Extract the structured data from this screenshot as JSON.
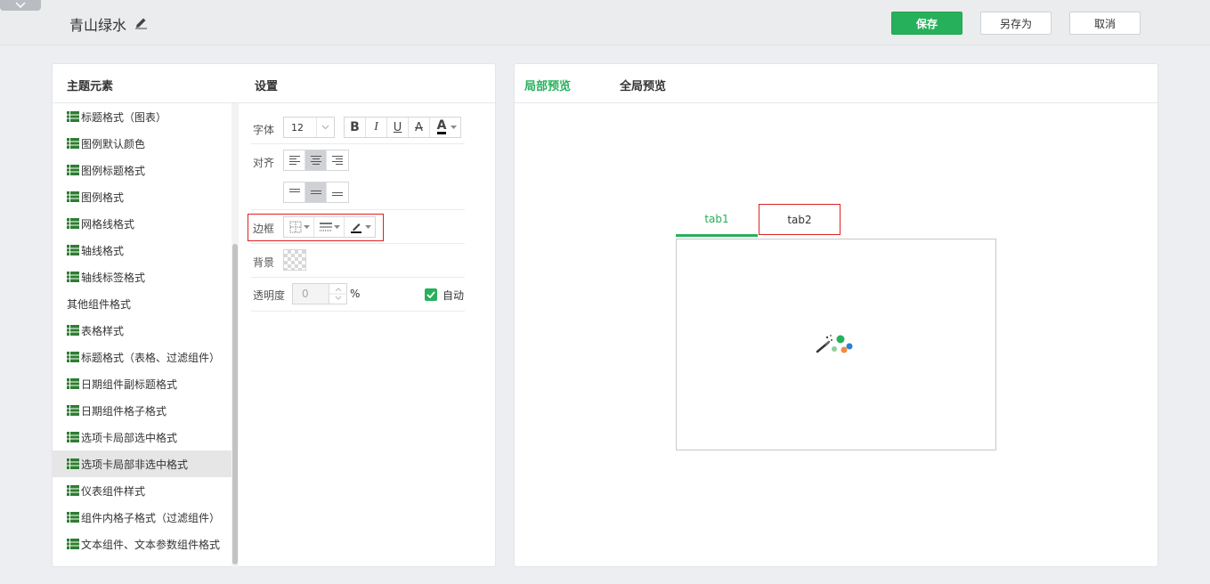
{
  "header": {
    "title": "青山绿水",
    "save_label": "保存",
    "save_as_label": "另存为",
    "cancel_label": "取消"
  },
  "left_panel": {
    "elements_header": "主题元素",
    "settings_header": "设置",
    "elements": [
      {
        "label": "标题格式（图表）",
        "icon": "list-icon"
      },
      {
        "label": "图例默认颜色",
        "icon": "list-icon"
      },
      {
        "label": "图例标题格式",
        "icon": "list-icon"
      },
      {
        "label": "图例格式",
        "icon": "list-icon"
      },
      {
        "label": "网格线格式",
        "icon": "list-icon"
      },
      {
        "label": "轴线格式",
        "icon": "list-icon"
      },
      {
        "label": "轴线标签格式",
        "icon": "list-icon"
      },
      {
        "label": "其他组件格式",
        "icon": ""
      },
      {
        "label": "表格样式",
        "icon": "list-icon"
      },
      {
        "label": "标题格式（表格、过滤组件）",
        "icon": "list-icon"
      },
      {
        "label": "日期组件副标题格式",
        "icon": "list-icon"
      },
      {
        "label": "日期组件格子格式",
        "icon": "list-icon"
      },
      {
        "label": "选项卡局部选中格式",
        "icon": "list-icon"
      },
      {
        "label": "选项卡局部非选中格式",
        "icon": "list-icon",
        "selected": true
      },
      {
        "label": "仪表组件样式",
        "icon": "list-icon"
      },
      {
        "label": "组件内格子格式（过滤组件）",
        "icon": "list-icon"
      },
      {
        "label": "文本组件、文本参数组件格式",
        "icon": "list-icon"
      }
    ],
    "settings": {
      "font_label": "字体",
      "font_size": "12",
      "bold": "B",
      "italic": "I",
      "underline": "U",
      "strike": "A",
      "font_color": "A",
      "align_label": "对齐",
      "border_label": "边框",
      "background_label": "背景",
      "opacity_label": "透明度",
      "opacity_value": "0",
      "opacity_unit": "%",
      "auto_label": "自动"
    }
  },
  "right_panel": {
    "local_preview_label": "局部预览",
    "global_preview_label": "全局预览",
    "tabs": [
      "tab1",
      "tab2"
    ]
  },
  "colors": {
    "accent": "#27b05b",
    "highlight_border": "#e02020"
  }
}
